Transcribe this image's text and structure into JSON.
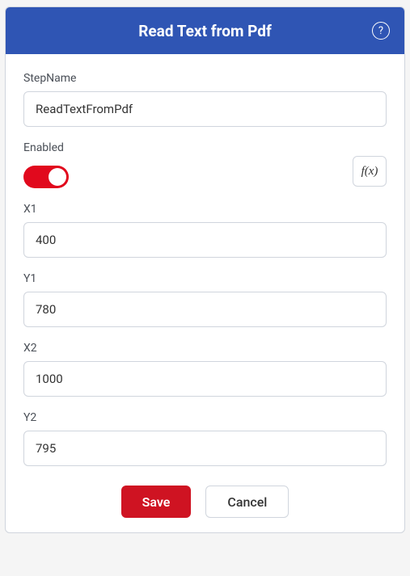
{
  "header": {
    "title": "Read Text from Pdf",
    "help_symbol": "?"
  },
  "fields": {
    "stepName": {
      "label": "StepName",
      "value": "ReadTextFromPdf"
    },
    "enabled": {
      "label": "Enabled",
      "on": true
    },
    "x1": {
      "label": "X1",
      "value": "400"
    },
    "y1": {
      "label": "Y1",
      "value": "780"
    },
    "x2": {
      "label": "X2",
      "value": "1000"
    },
    "y2": {
      "label": "Y2",
      "value": "795"
    }
  },
  "fx_label": "f(x)",
  "buttons": {
    "save": "Save",
    "cancel": "Cancel"
  }
}
